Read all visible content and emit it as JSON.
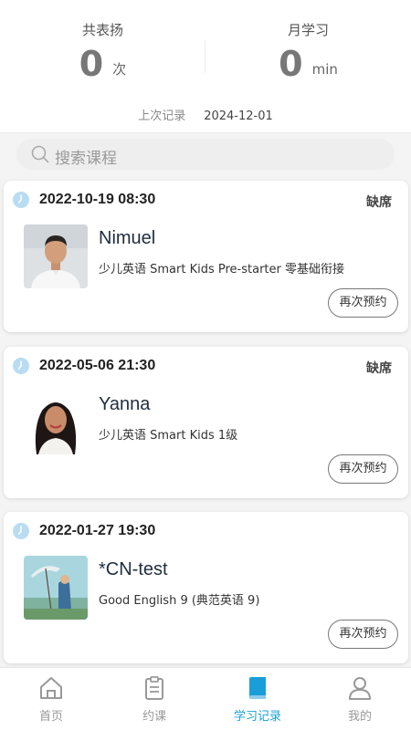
{
  "stats": {
    "praise_label": "共表扬",
    "praise_value": "0",
    "praise_unit": "次",
    "monthly_label": "月学习",
    "monthly_value": "0",
    "monthly_unit": "min",
    "last_record_label": "上次记录",
    "last_record_date": "2024-12-01"
  },
  "search": {
    "placeholder": "搜索课程",
    "icon": "search-icon"
  },
  "records": [
    {
      "datetime": "2022-10-19 08:30",
      "status": "缺席",
      "teacher": "Nimuel",
      "course": "少儿英语 Smart Kids Pre-starter 零基础衔接",
      "button": "再次预约"
    },
    {
      "datetime": "2022-05-06 21:30",
      "status": "缺席",
      "teacher": "Yanna",
      "course": "少儿英语 Smart Kids 1级",
      "button": "再次预约"
    },
    {
      "datetime": "2022-01-27 19:30",
      "status": "",
      "teacher": "*CN-test",
      "course": "Good English 9 (典范英语 9)",
      "button": "再次预约"
    }
  ],
  "tabbar": {
    "items": [
      {
        "label": "首页",
        "icon": "home-icon",
        "active": false
      },
      {
        "label": "约课",
        "icon": "clipboard-icon",
        "active": false
      },
      {
        "label": "学习记录",
        "icon": "book-icon",
        "active": true
      },
      {
        "label": "我的",
        "icon": "user-icon",
        "active": false
      }
    ]
  },
  "colors": {
    "accent": "#1a9ed9",
    "clock_icon": "#b9dcf2",
    "inactive_tab": "#999999"
  }
}
